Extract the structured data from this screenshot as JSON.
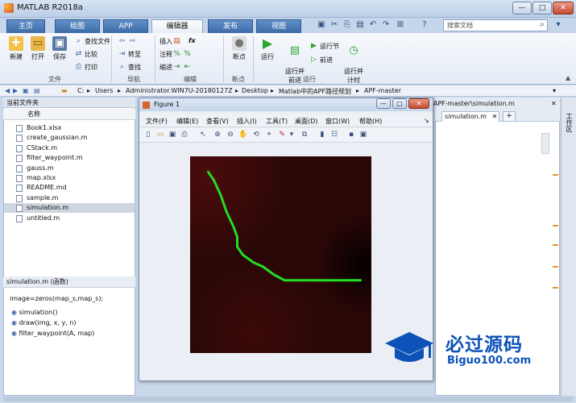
{
  "window": {
    "title": "MATLAB R2018a",
    "minimize": "—",
    "maximize": "□",
    "close": "✕"
  },
  "tabs": [
    {
      "label": "主页"
    },
    {
      "label": "绘图"
    },
    {
      "label": "APP"
    },
    {
      "label": "编辑器"
    },
    {
      "label": "发布"
    },
    {
      "label": "视图"
    }
  ],
  "search": {
    "placeholder": "搜索文档"
  },
  "ribbon": {
    "file_group": {
      "new": "新建",
      "open": "打开",
      "save": "保存",
      "find_files": "查找文件",
      "compare": "比较",
      "print": "打印",
      "label": "文件"
    },
    "nav_group": {
      "goto": "转至",
      "find": "查找",
      "label": "导航"
    },
    "edit_group": {
      "insert": "插入",
      "comment": "注释",
      "indent": "缩进",
      "fx": "fx",
      "label": "编辑"
    },
    "breakpoint_group": {
      "breakpoints": "断点",
      "label": "断点"
    },
    "run_group": {
      "run": "运行",
      "run_advance": "运行并\n前进",
      "run_section": "运行节",
      "advance": "前进",
      "run_time": "运行并\n计时",
      "label": "运行"
    }
  },
  "address": {
    "parts": [
      "C:",
      "Users",
      "Administrator.WIN7U-20180127Z",
      "Desktop",
      "Matlab中的APF路径规划",
      "APF-master"
    ]
  },
  "current_folder": {
    "title": "当前文件夹",
    "column": "名称",
    "files": [
      "Book1.xlsx",
      "create_gaussian.m",
      "CStack.m",
      "filter_waypoint.m",
      "gauss.m",
      "map.xlsx",
      "README.md",
      "sample.m",
      "simulation.m",
      "untitled.m"
    ],
    "selected": "simulation.m"
  },
  "details": {
    "title": "simulation.m  (函数)",
    "code": "image=zeros(map_s,map_s);",
    "items": [
      "simulation()",
      "draw(img, x, y, n)",
      "filter_waypoint(A, map)"
    ]
  },
  "editor": {
    "path": "APF-master\\simulation.m",
    "tab": "simulation.m",
    "add_tab": "+",
    "workspace": "工作区"
  },
  "figure": {
    "title": "Figure 1",
    "menus": [
      "文件(F)",
      "编辑(E)",
      "查看(V)",
      "插入(I)",
      "工具(T)",
      "桌面(D)",
      "窗口(W)",
      "帮助(H)"
    ]
  },
  "chart_data": {
    "type": "line",
    "title": "",
    "xlabel": "",
    "ylabel": "",
    "xlim": [
      0,
      100
    ],
    "ylim": [
      0,
      100
    ],
    "background": "#2a0707",
    "line_color": "#22dd22",
    "series": [
      {
        "x": [
          10,
          13,
          17,
          20,
          24,
          26,
          26,
          29,
          35,
          40,
          46,
          52,
          58,
          64,
          70,
          76,
          82,
          88,
          94
        ],
        "y": [
          92,
          88,
          80,
          72,
          64,
          59,
          54,
          50,
          46,
          44,
          40,
          37,
          37,
          37,
          37,
          37,
          37,
          37,
          37
        ]
      }
    ]
  },
  "watermark": {
    "text1": "必过源码",
    "text2": "Biguo100.com"
  }
}
